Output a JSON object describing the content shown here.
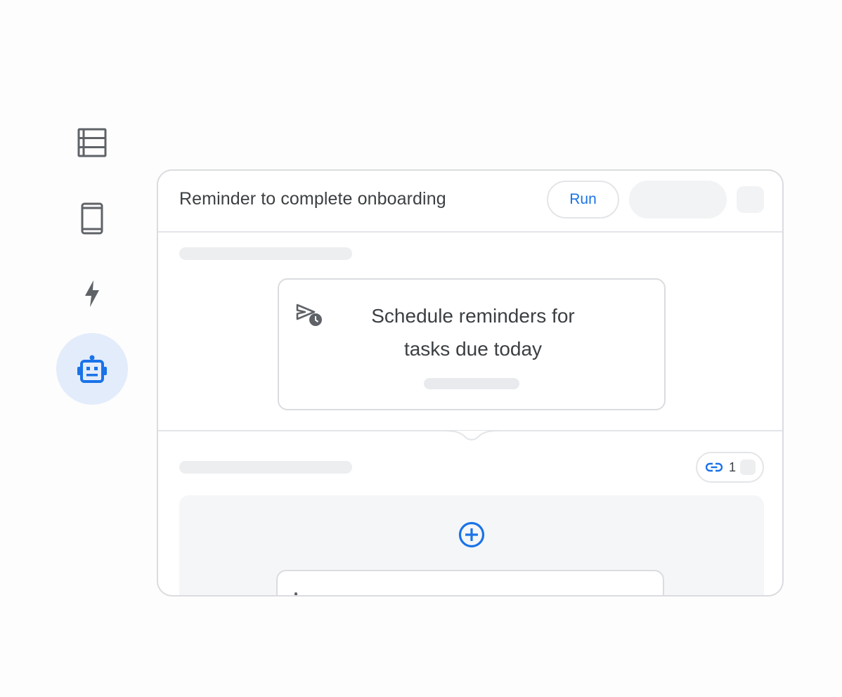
{
  "rail": {
    "items": [
      {
        "icon": "table-rows-icon",
        "active": false
      },
      {
        "icon": "phone-icon",
        "active": false
      },
      {
        "icon": "bolt-icon",
        "active": false
      },
      {
        "icon": "robot-icon",
        "active": true
      }
    ]
  },
  "automation": {
    "title": "Reminder to complete onboarding",
    "run_label": "Run"
  },
  "step": {
    "icon": "send-schedule-icon",
    "line1": "Schedule reminders for",
    "line2": "tasks due today"
  },
  "links": {
    "icon": "link-icon",
    "count": "1"
  },
  "add_step": {
    "icon": "add-circle-icon"
  },
  "colors": {
    "accent": "#1a73e8",
    "active_bg": "#e3ecfb",
    "icon_gray": "#5f6368",
    "border": "#dadce0",
    "placeholder": "#eceef0"
  }
}
